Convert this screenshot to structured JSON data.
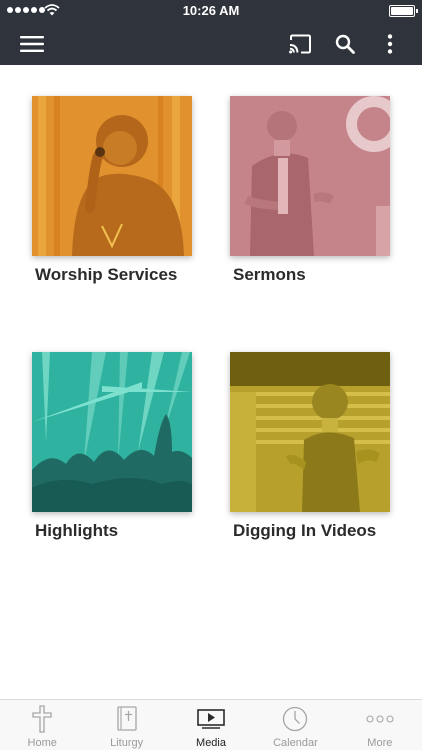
{
  "status_bar": {
    "time": "10:26 AM"
  },
  "toolbar": {
    "menu_icon": "hamburger-menu-icon",
    "cast_icon": "cast-icon",
    "search_icon": "search-icon",
    "more_icon": "vertical-ellipsis-icon"
  },
  "media": {
    "items": [
      {
        "title": "Worship Services",
        "tint": "#e1912d"
      },
      {
        "title": "Sermons",
        "tint": "#c4848a"
      },
      {
        "title": "Highlights",
        "tint": "#2fb3a0"
      },
      {
        "title": "Digging In Videos",
        "tint": "#b7a02c"
      }
    ]
  },
  "tabs": [
    {
      "label": "Home",
      "icon": "cross-icon",
      "active": false
    },
    {
      "label": "Liturgy",
      "icon": "bible-icon",
      "active": false
    },
    {
      "label": "Media",
      "icon": "play-icon",
      "active": true
    },
    {
      "label": "Calendar",
      "icon": "clock-icon",
      "active": false
    },
    {
      "label": "More",
      "icon": "more-icon",
      "active": false
    }
  ],
  "colors": {
    "bar_background": "#2f333b",
    "tab_background": "#f8f8f8",
    "text": "#2b2b2b"
  }
}
